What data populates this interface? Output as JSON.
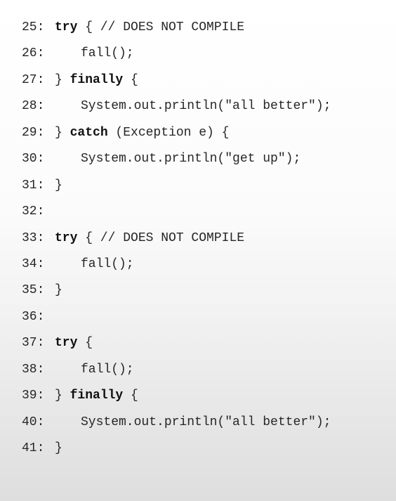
{
  "code": {
    "lines": [
      {
        "no": "25:",
        "pre": "",
        "kw": "try",
        "post": " { // DOES NOT COMPILE"
      },
      {
        "no": "26:",
        "body": "fall();"
      },
      {
        "no": "27:",
        "pre": "} ",
        "kw": "finally",
        "post": " {"
      },
      {
        "no": "28:",
        "body": "System.out.println(\"all better\");"
      },
      {
        "no": "29:",
        "pre": "} ",
        "kw": "catch",
        "post": " (Exception e) {"
      },
      {
        "no": "30:",
        "body": "System.out.println(\"get up\");"
      },
      {
        "no": "31:",
        "pre": "}"
      },
      {
        "no": "32:"
      },
      {
        "no": "33:",
        "pre": "",
        "kw": "try",
        "post": " { // DOES NOT COMPILE"
      },
      {
        "no": "34:",
        "body": "fall();"
      },
      {
        "no": "35:",
        "pre": "}"
      },
      {
        "no": "36:"
      },
      {
        "no": "37:",
        "pre": "",
        "kw": "try",
        "post": " {"
      },
      {
        "no": "38:",
        "body": "fall();"
      },
      {
        "no": "39:",
        "pre": "} ",
        "kw": "finally",
        "post": " {"
      },
      {
        "no": "40:",
        "body": "System.out.println(\"all better\");"
      },
      {
        "no": "41:",
        "pre": "}"
      }
    ]
  }
}
